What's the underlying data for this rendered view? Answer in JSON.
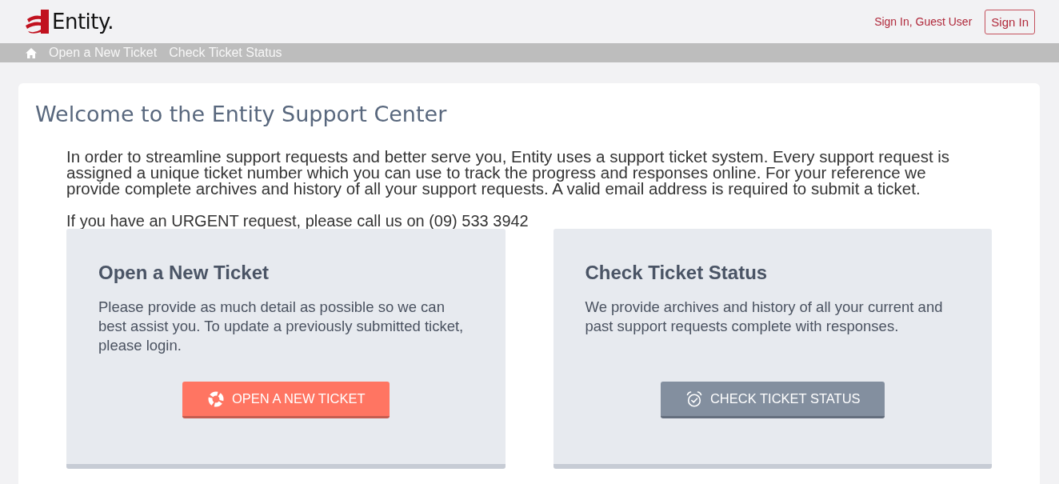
{
  "header": {
    "logo_text": "Entity.",
    "user_text": "Sign In, Guest User",
    "sign_in_button": "Sign In"
  },
  "nav": {
    "items": [
      {
        "label": "Open a New Ticket"
      },
      {
        "label": "Check Ticket Status"
      }
    ]
  },
  "main": {
    "title": "Welcome to the Entity Support Center",
    "intro": "In order to streamline support requests and better serve you, Entity uses a support ticket system. Every support request is assigned a unique ticket number which you can use to track the progress and responses online. For your reference we provide complete archives and history of all your support requests. A valid email address is required to submit a ticket.",
    "urgent": "If you have an URGENT request, please call us on (09) 533 3942"
  },
  "cards": [
    {
      "kind": "open",
      "title": "Open a New Ticket",
      "text": "Please provide as much detail as possible so we can best assist you. To update a previously submitted ticket, please login.",
      "button": "OPEN A NEW TICKET"
    },
    {
      "kind": "check",
      "title": "Check Ticket Status",
      "text": "We provide archives and history of all your current and past support requests complete with responses.",
      "button": "CHECK TICKET STATUS"
    }
  ]
}
